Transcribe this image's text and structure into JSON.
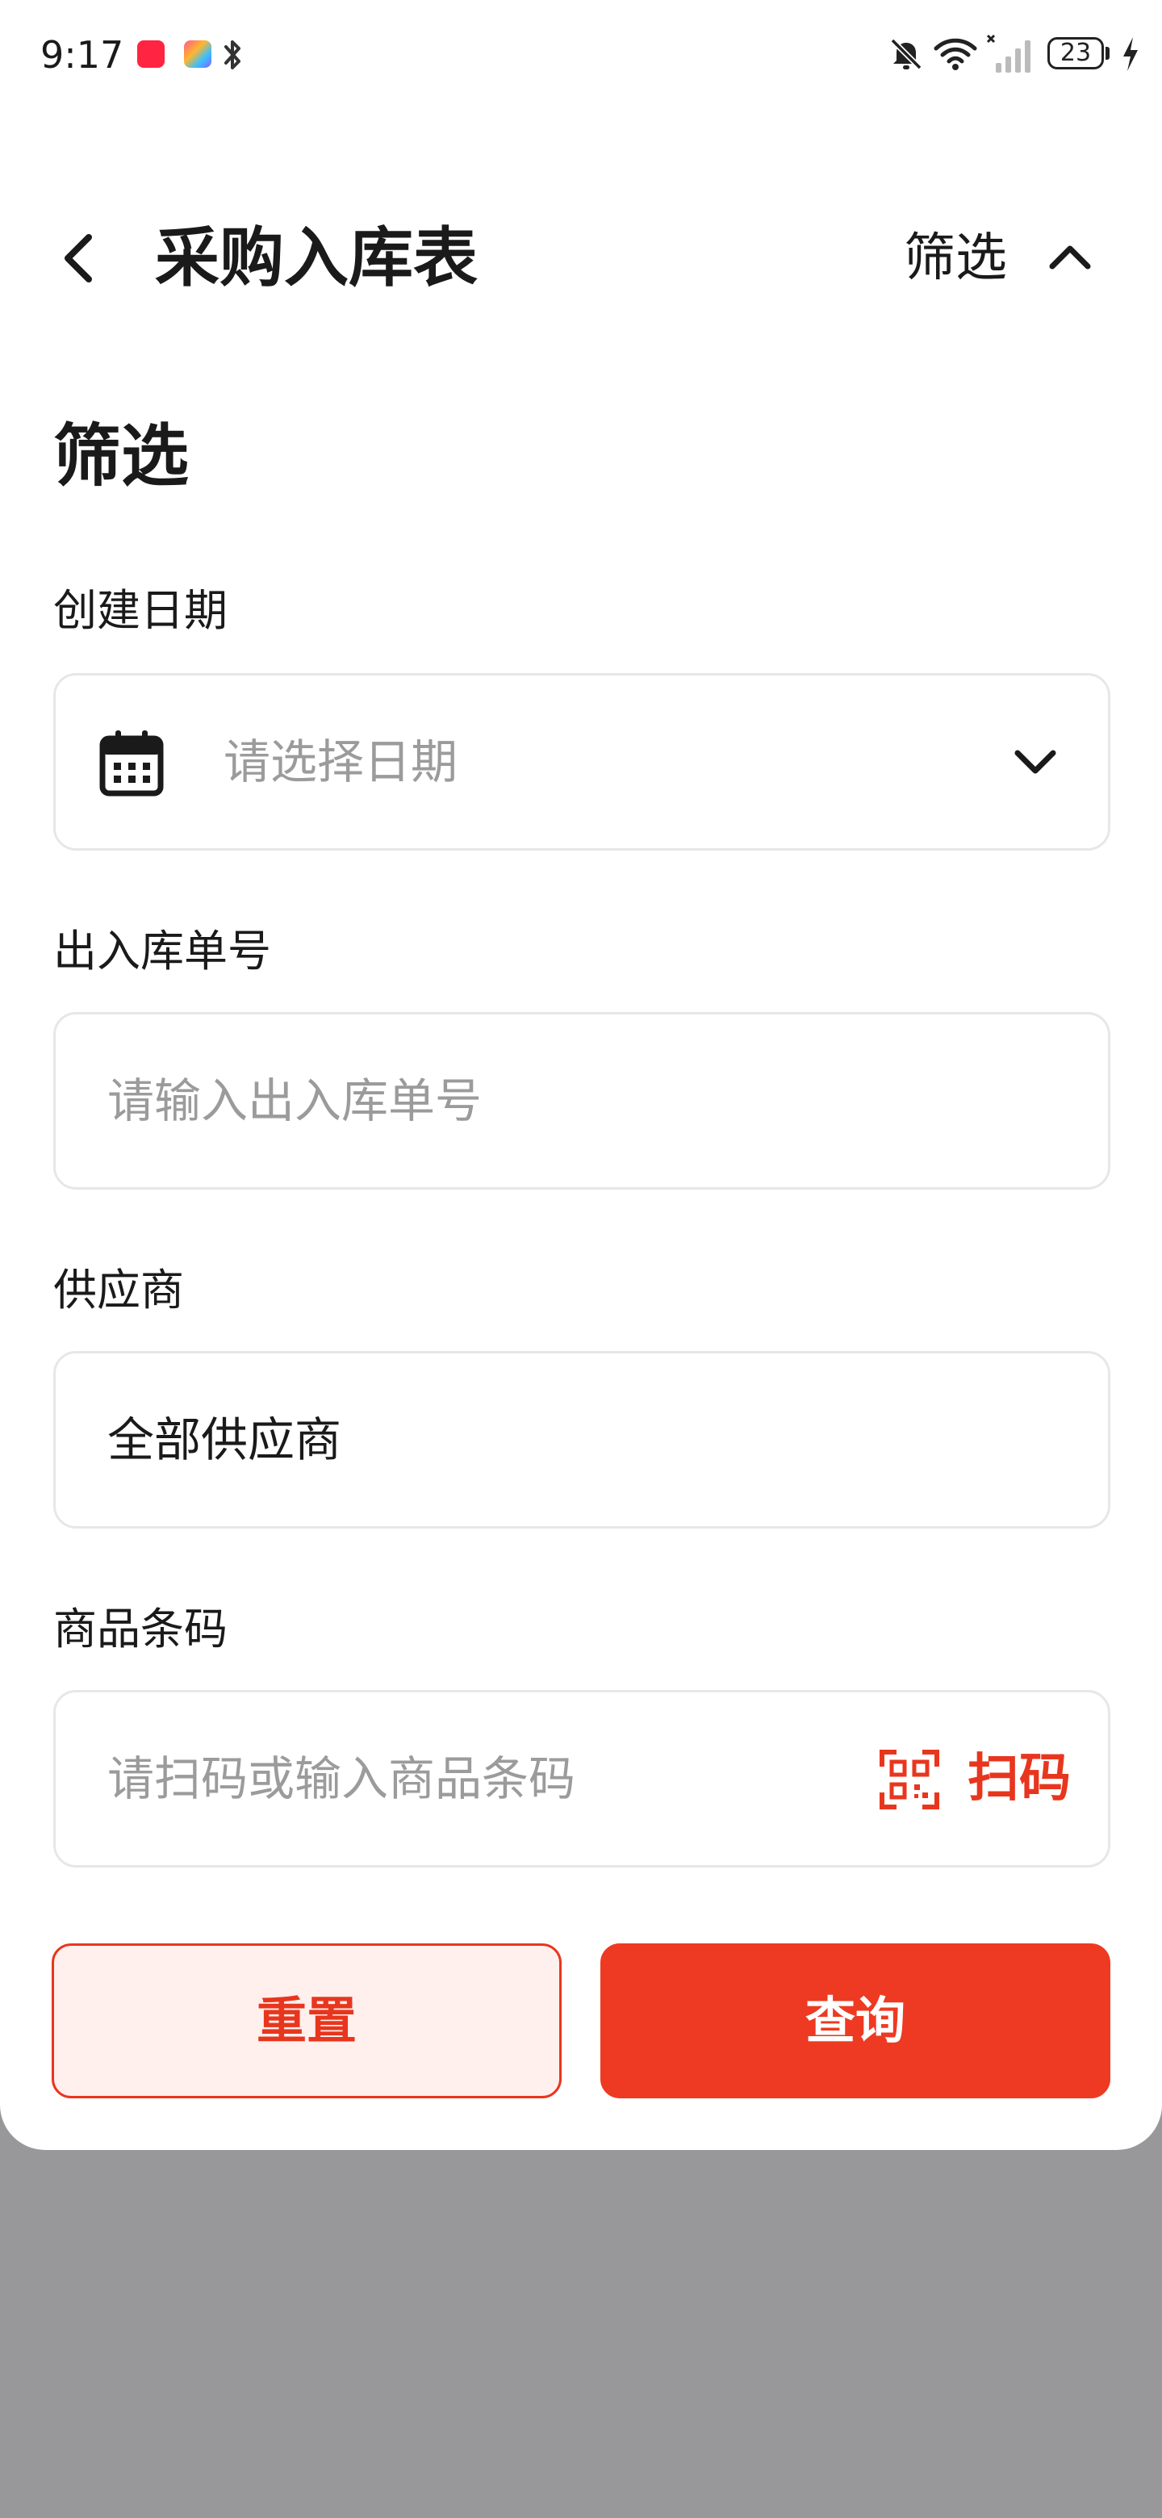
{
  "status_bar": {
    "time": "9:17",
    "battery": "23",
    "icons": [
      "xiaohongshu-app-icon",
      "colorful-app-icon",
      "bluetooth-icon",
      "notifications-off-icon",
      "wifi-icon",
      "cellular-signal-icon",
      "battery-icon",
      "charging-icon"
    ]
  },
  "header": {
    "title": "采购入库表",
    "filter_label": "筛选"
  },
  "filter": {
    "section_title": "筛选",
    "date": {
      "label": "创建日期",
      "placeholder": "请选择日期"
    },
    "order_no": {
      "label": "出入库单号",
      "placeholder": "请输入出入库单号"
    },
    "supplier": {
      "label": "供应商",
      "value": "全部供应商"
    },
    "barcode": {
      "label": "商品条码",
      "placeholder": "请扫码或输入商品条码",
      "scan_label": "扫码"
    }
  },
  "actions": {
    "reset_label": "重置",
    "query_label": "查询"
  },
  "colors": {
    "accent": "#ee3a22",
    "reset_bg": "#fff0ee",
    "overlay": "#98989b"
  }
}
